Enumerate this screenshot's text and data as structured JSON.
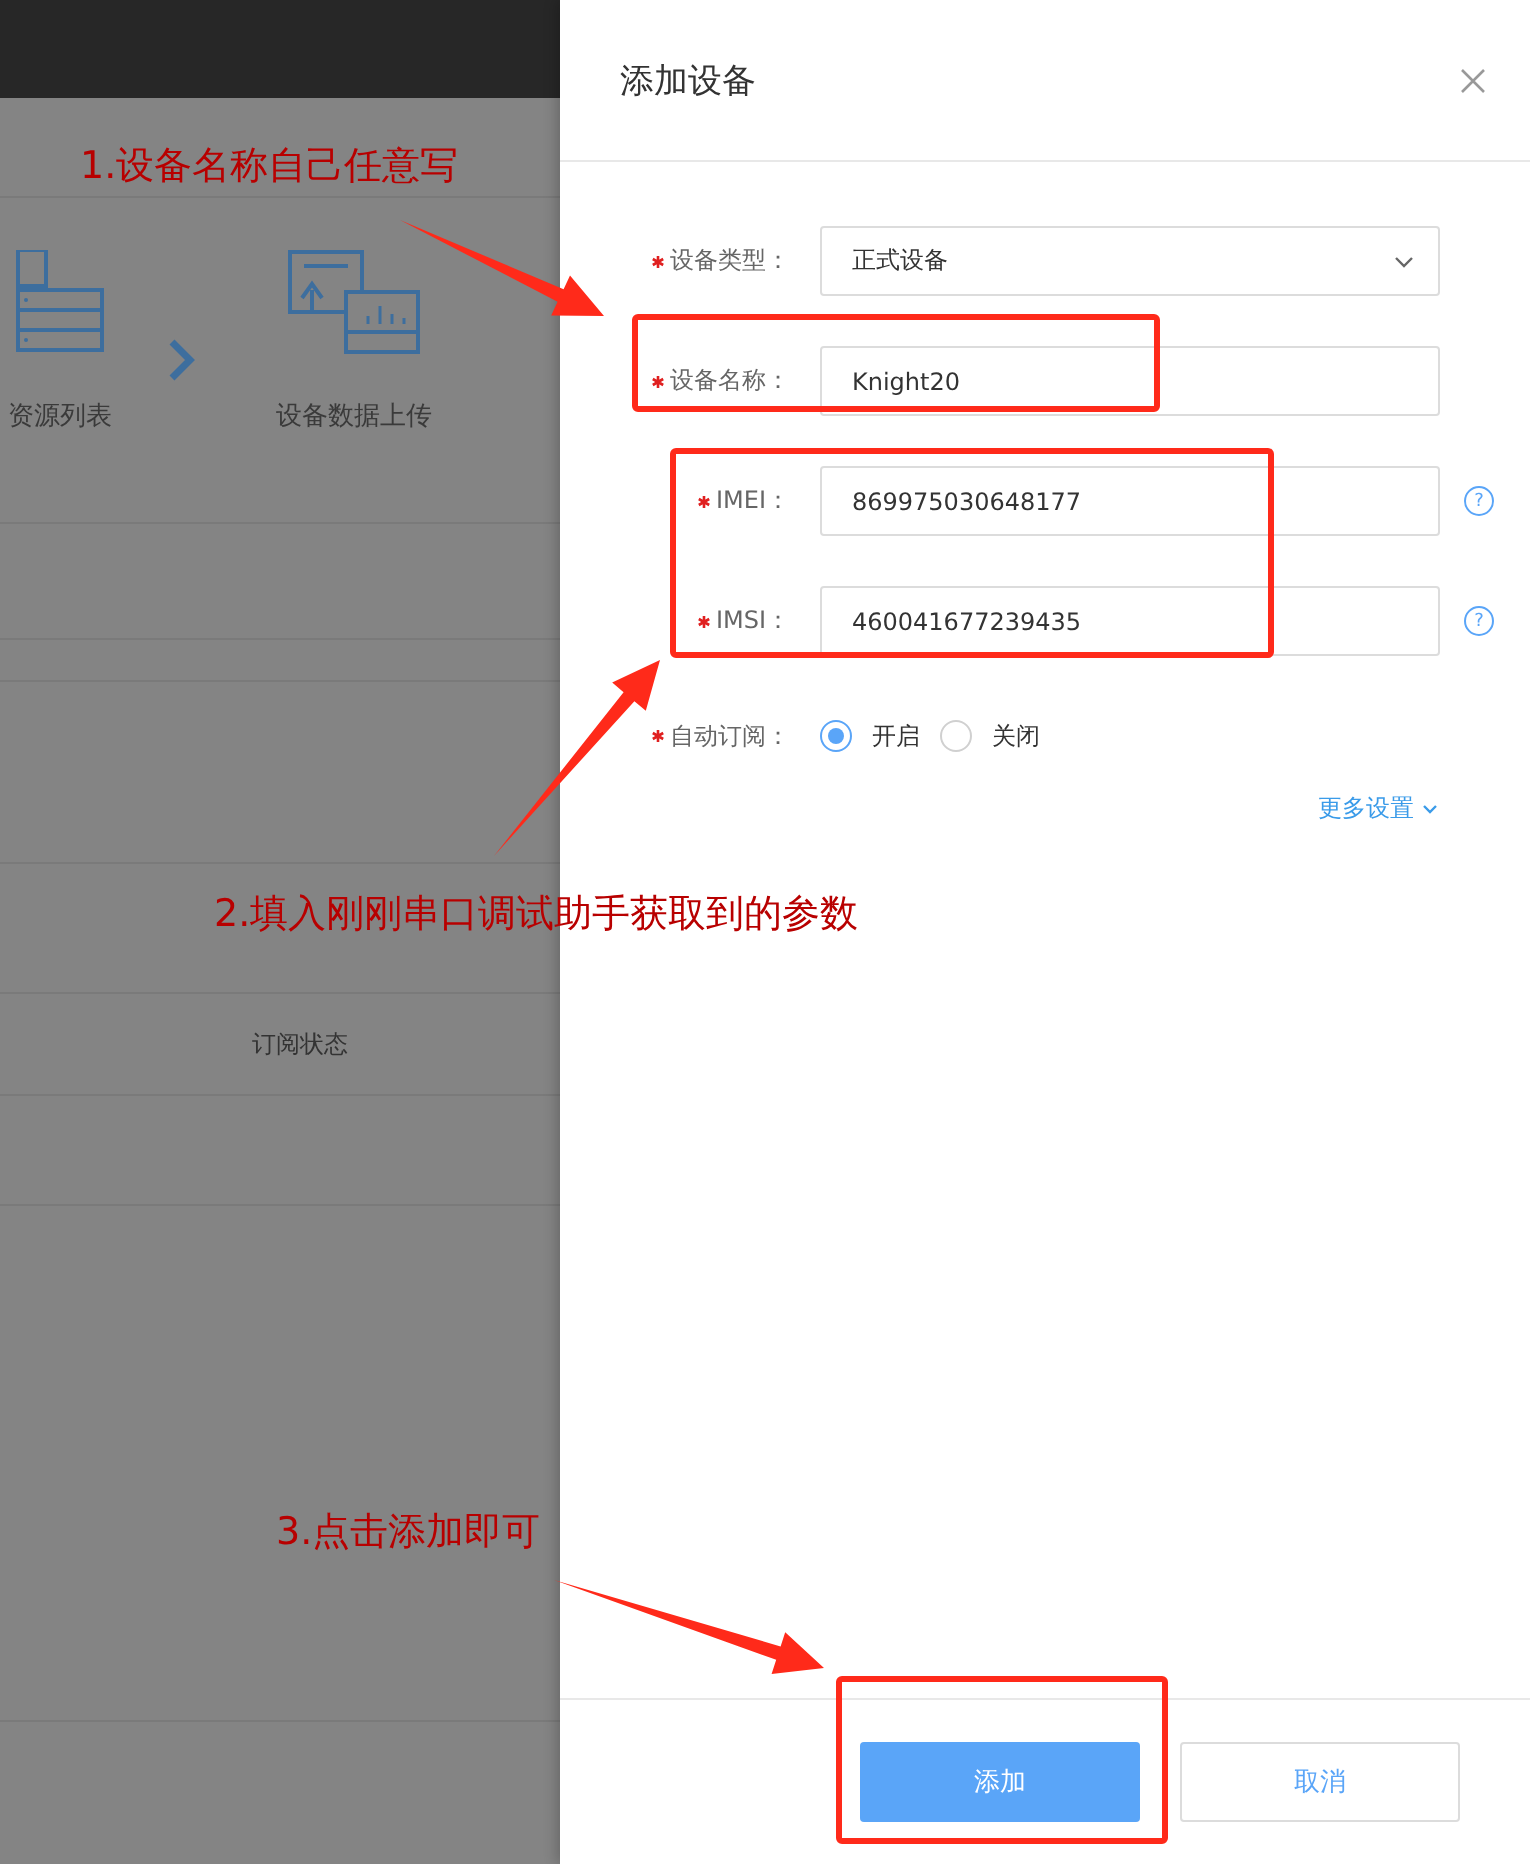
{
  "background_page": {
    "steps": [
      {
        "label": "资源列表"
      },
      {
        "label": "设备数据上传"
      }
    ],
    "table": {
      "columns": [
        "订阅状态"
      ]
    }
  },
  "drawer": {
    "title": "添加设备",
    "fields": [
      {
        "kind": "select",
        "required": true,
        "label": "设备类型：",
        "value": "正式设备"
      },
      {
        "kind": "text",
        "required": true,
        "label": "设备名称：",
        "value": "Knight20"
      },
      {
        "kind": "text",
        "required": true,
        "label": "IMEI：",
        "value": "869975030648177",
        "help": "?"
      },
      {
        "kind": "text",
        "required": true,
        "label": "IMSI：",
        "value": "460041677239435",
        "help": "?"
      },
      {
        "kind": "radio",
        "required": true,
        "label": "自动订阅：",
        "options": [
          {
            "label": "开启",
            "selected": true
          },
          {
            "label": "关闭",
            "selected": false
          }
        ]
      }
    ],
    "more_settings": "更多设置",
    "buttons": [
      {
        "label": "添加",
        "kind": "primary"
      },
      {
        "label": "取消",
        "kind": "default"
      }
    ]
  },
  "annotations": [
    {
      "text": "1.设备名称自己任意写"
    },
    {
      "text": "2.填入刚刚串口调试助手获取到的参数"
    },
    {
      "text": "3.点击添加即可"
    }
  ]
}
